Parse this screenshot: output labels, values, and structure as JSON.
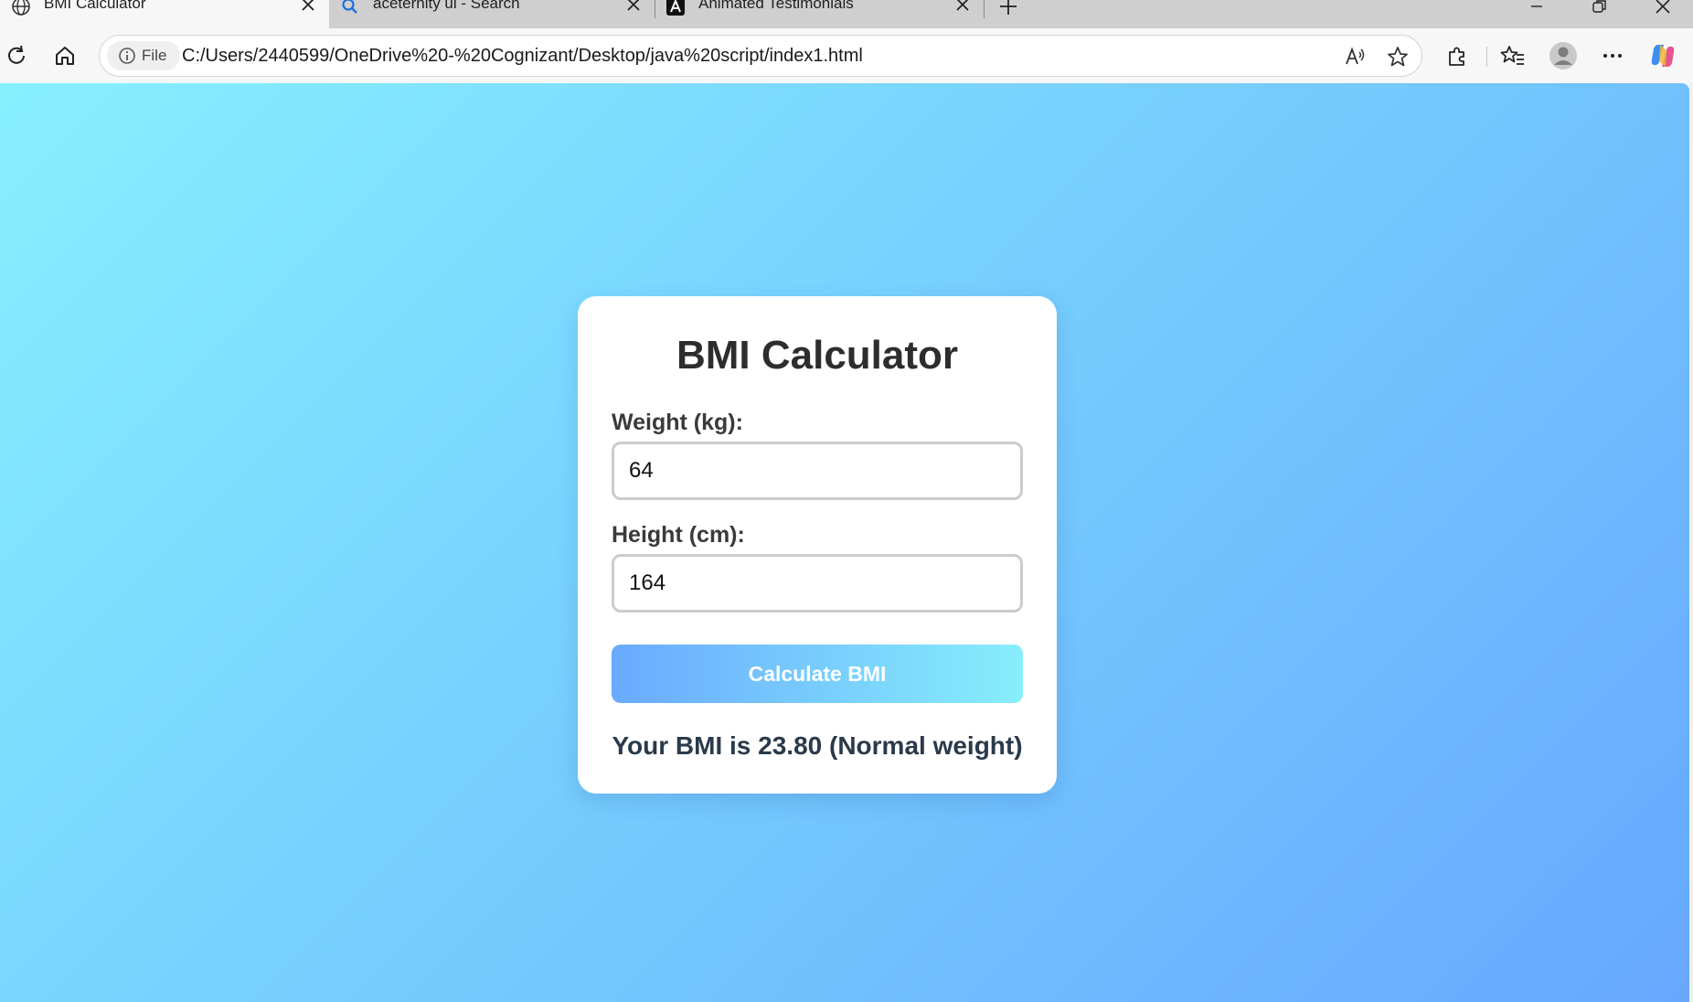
{
  "browser": {
    "tabs": [
      {
        "title": "BMI Calculator",
        "icon": "globe-icon",
        "active": true
      },
      {
        "title": "aceternity ui - Search",
        "icon": "search-icon",
        "active": false
      },
      {
        "title": "Animated Testimonials",
        "icon": "aceternity-logo-icon",
        "active": false
      }
    ],
    "address": {
      "scheme_label": "File",
      "url": "C:/Users/2440599/OneDrive%20-%20Cognizant/Desktop/java%20script/index1.html"
    }
  },
  "app": {
    "title": "BMI Calculator",
    "weight": {
      "label": "Weight (kg):",
      "value": "64"
    },
    "height": {
      "label": "Height (cm):",
      "value": "164"
    },
    "button_label": "Calculate BMI",
    "result": "Your BMI is 23.80 (Normal weight)"
  },
  "colors": {
    "background_gradient_start": "#87f0ff",
    "background_gradient_end": "#66a8fe",
    "button_gradient_start": "#69aafe",
    "button_gradient_end": "#87eefc",
    "title_text": "#2d2d2d",
    "result_text": "#2a3a4a"
  }
}
